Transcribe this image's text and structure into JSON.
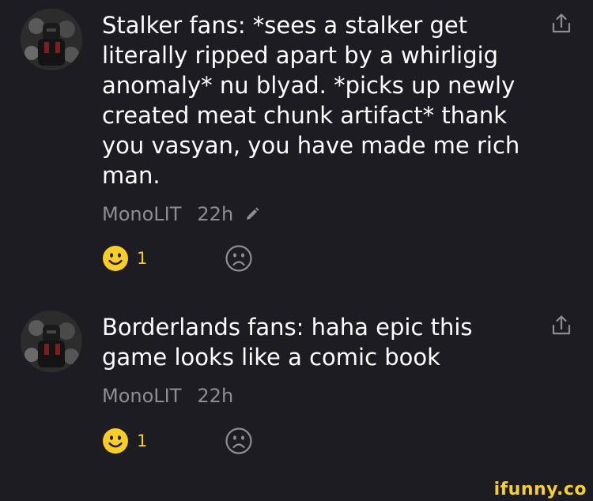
{
  "comments": [
    {
      "text": "Stalker fans: *sees a stalker get literally ripped apart by a whirligig anomaly* nu blyad. *picks up newly created meat chunk artifact* thank you vasyan, you have made me rich man.",
      "author": "MonoLIT",
      "time": "22h",
      "edited": true,
      "smile_count": "1",
      "icons": {
        "share": "share-icon",
        "smile": "smile-icon",
        "frown": "frown-icon",
        "edit": "pencil-icon"
      }
    },
    {
      "text": "Borderlands fans: haha epic this game looks like a comic book",
      "author": "MonoLIT",
      "time": "22h",
      "edited": false,
      "smile_count": "1",
      "icons": {
        "share": "share-icon",
        "smile": "smile-icon",
        "frown": "frown-icon"
      }
    }
  ],
  "watermark": "ifunny.co",
  "colors": {
    "background": "#1d1c22",
    "text": "#ffffff",
    "meta": "#8e8d93",
    "accent_yellow": "#f8cd2a"
  }
}
